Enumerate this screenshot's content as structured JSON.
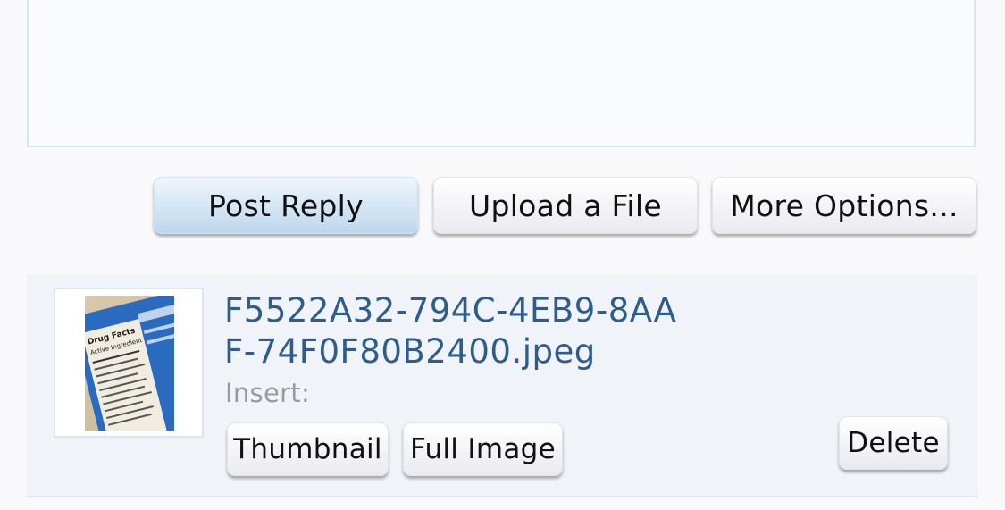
{
  "actions": {
    "post_reply": "Post Reply",
    "upload_file": "Upload a File",
    "more_options": "More Options..."
  },
  "attachment": {
    "filename": "F5522A32-794C-4EB9-8AAF-74F0F80B2400.jpeg",
    "insert_label": "Insert:",
    "thumbnail_button": "Thumbnail",
    "full_image_button": "Full Image",
    "delete_button": "Delete",
    "thumbnail_image_label": "Drug Facts",
    "thumbnail_image_sublabel": "Active Ingredient"
  },
  "colors": {
    "link": "#2e5d8b",
    "primary_button": "#bdd6ec",
    "panel_bg": "#f0f4f9"
  }
}
